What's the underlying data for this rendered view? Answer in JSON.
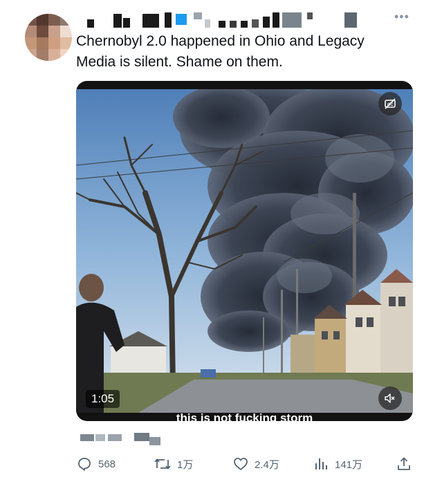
{
  "tweet": {
    "text": "Chernobyl 2.0 happened in Ohio and Legacy\nMedia is silent. Shame on them.",
    "more_icon": "more-horizontal-icon",
    "avatar": "avatar-image"
  },
  "media": {
    "duration": "1:05",
    "subtitle": "this is not fucking storm",
    "captions_icon": "captions-off-icon",
    "mute_icon": "volume-muted-icon"
  },
  "actions": {
    "reply_count": "568",
    "retweet_count": "1万",
    "like_count": "2.4万",
    "views_count": "141万"
  },
  "colors": {
    "text": "#0f1419",
    "secondary": "#536471",
    "smoke": "#3a4150"
  }
}
